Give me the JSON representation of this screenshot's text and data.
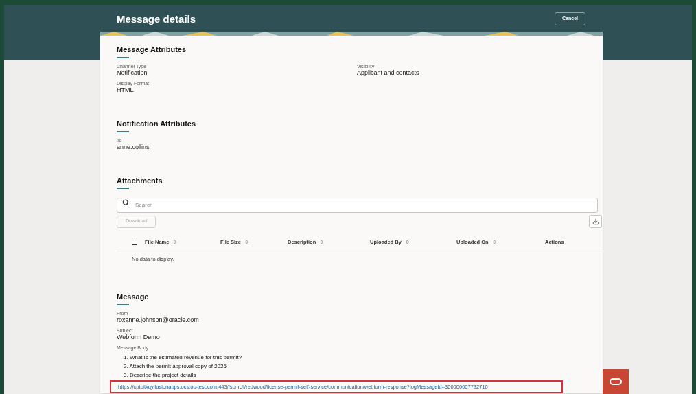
{
  "dialog": {
    "title": "Message details",
    "cancel_button": "Cancel"
  },
  "sections": [
    {
      "title": "Message Attributes",
      "fields": [
        {
          "label": "Channel Type",
          "value": "Notification"
        },
        {
          "label": "Visibility",
          "value": "Applicant and contacts"
        },
        {
          "label": "Display Format",
          "value": "HTML"
        }
      ]
    },
    {
      "title": "Notification Attributes",
      "fields": [
        {
          "label": "To",
          "value": "anne.collins"
        }
      ]
    }
  ],
  "attachments": {
    "title": "Attachments",
    "search": {
      "placeholder": "Search"
    },
    "download_button": {
      "label": "Download",
      "disabled": true
    },
    "select_all": {
      "checked": false
    },
    "columns": [
      {
        "label": "File Name",
        "sortable": true
      },
      {
        "label": "File Size",
        "sortable": true
      },
      {
        "label": "Description",
        "sortable": true
      },
      {
        "label": "Uploaded By",
        "sortable": true
      },
      {
        "label": "Uploaded On",
        "sortable": true
      },
      {
        "label": "Actions",
        "sortable": false
      }
    ],
    "empty_text": "No data to display."
  },
  "message": {
    "title": "Message",
    "fields": [
      {
        "label": "From",
        "value": "roxanne.johnson@oracle.com"
      },
      {
        "label": "Subject",
        "value": "Webform Demo"
      }
    ],
    "body_label": "Message Body",
    "body_items": [
      "1. What is the estimated revenue for this permit?",
      "2. Attach the permit approval copy of 2025",
      "3. Describe the project details"
    ],
    "link": "https://cptcitkqy.fusionapps.ocs.oc-test.com:443/fscmUI/redwood/license-permit-self-service/communication/webform-response?logMessageId=300000007732710",
    "link_highlighted": true
  }
}
